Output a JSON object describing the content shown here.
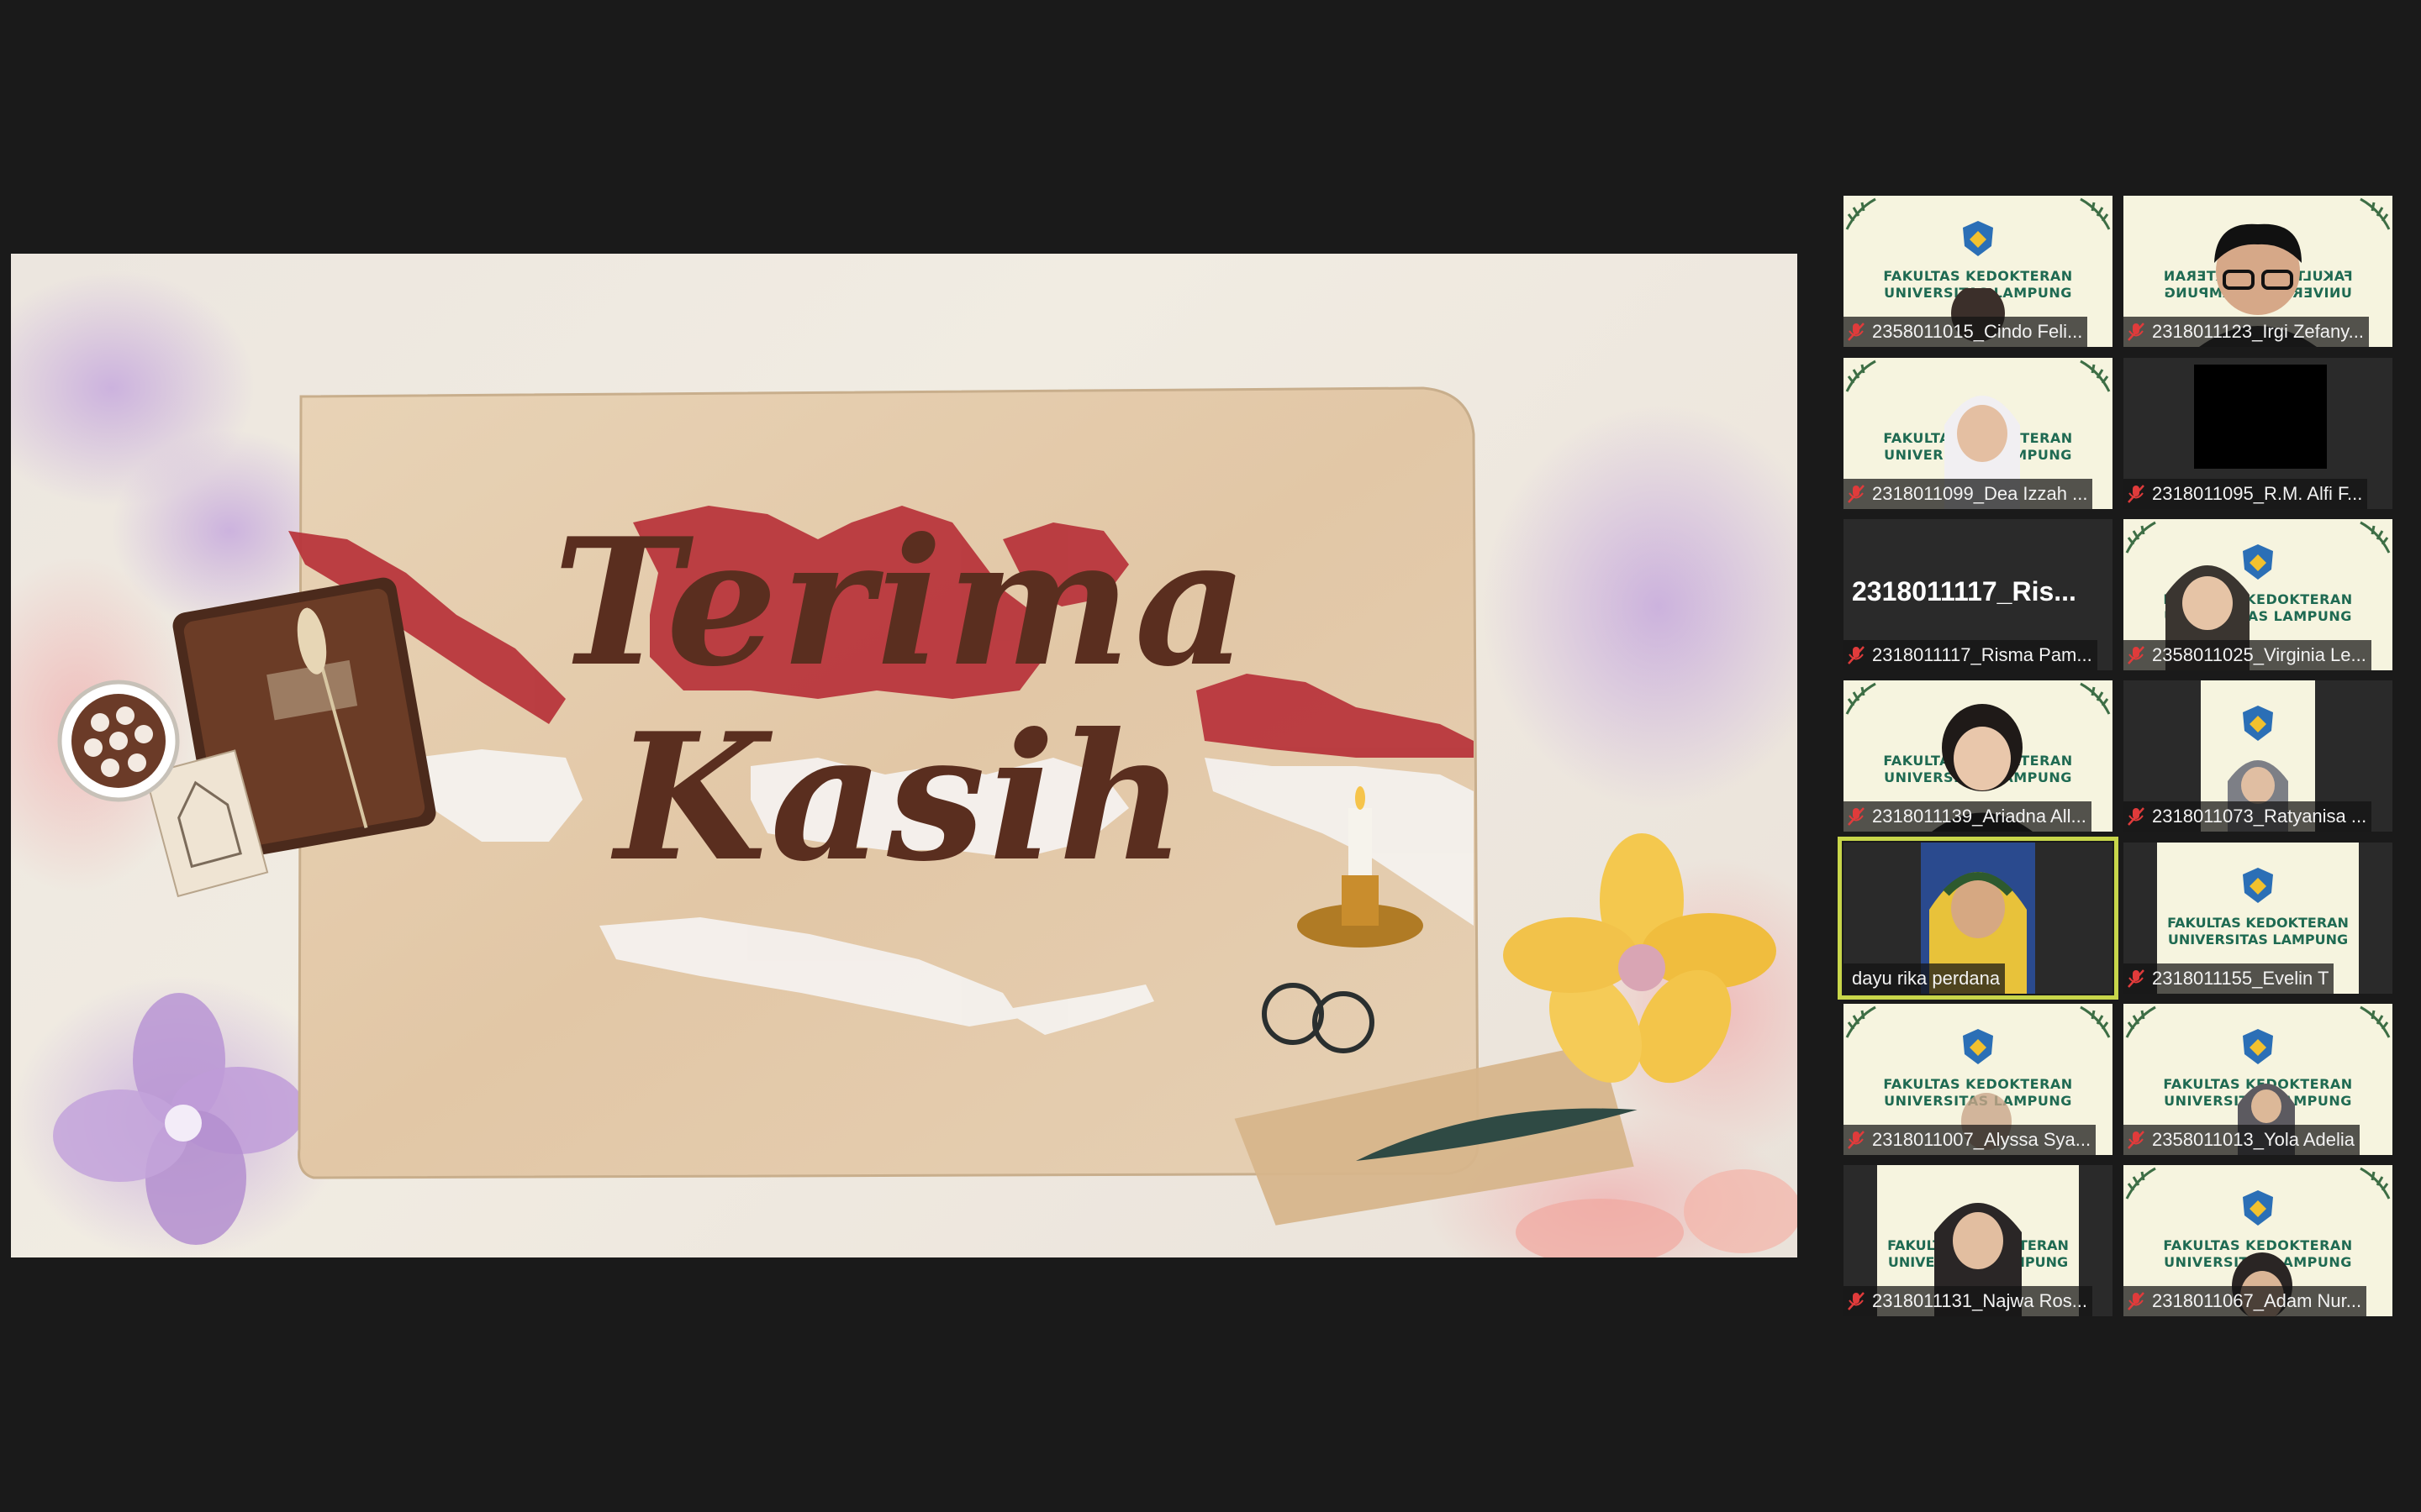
{
  "slide": {
    "title_line1": "Terima",
    "title_line2": "Kasih"
  },
  "tile_text": {
    "faculty_line1": "FAKULTAS KEDOKTERAN",
    "faculty_line2": "UNIVERSITAS LAMPUNG"
  },
  "participants": [
    {
      "name": "2358011015_Cindo Feli...",
      "muted": true
    },
    {
      "name": "2318011123_Irgi Zefany...",
      "muted": true
    },
    {
      "name": "2318011099_Dea Izzah ...",
      "muted": true
    },
    {
      "name": "2318011095_R.M. Alfi F...",
      "muted": true
    },
    {
      "name": "2318011117_Risma Pam...",
      "muted": true,
      "big_name": "2318011117_Ris..."
    },
    {
      "name": "2358011025_Virginia Le...",
      "muted": true
    },
    {
      "name": "2318011139_Ariadna All...",
      "muted": true
    },
    {
      "name": "2318011073_Ratyanisa ...",
      "muted": true
    },
    {
      "name": "dayu rika perdana",
      "muted": false,
      "active_speaker": true
    },
    {
      "name": "2318011155_Evelin T",
      "muted": true
    },
    {
      "name": "2318011007_Alyssa Sya...",
      "muted": true
    },
    {
      "name": "2358011013_Yola Adelia",
      "muted": true
    },
    {
      "name": "2318011131_Najwa Ros...",
      "muted": true
    },
    {
      "name": "2318011067_Adam Nur...",
      "muted": true
    }
  ],
  "colors": {
    "active_speaker_border": "#c8d64a",
    "mute_icon": "#e03b3b",
    "title_brown": "#5a2e1f"
  }
}
